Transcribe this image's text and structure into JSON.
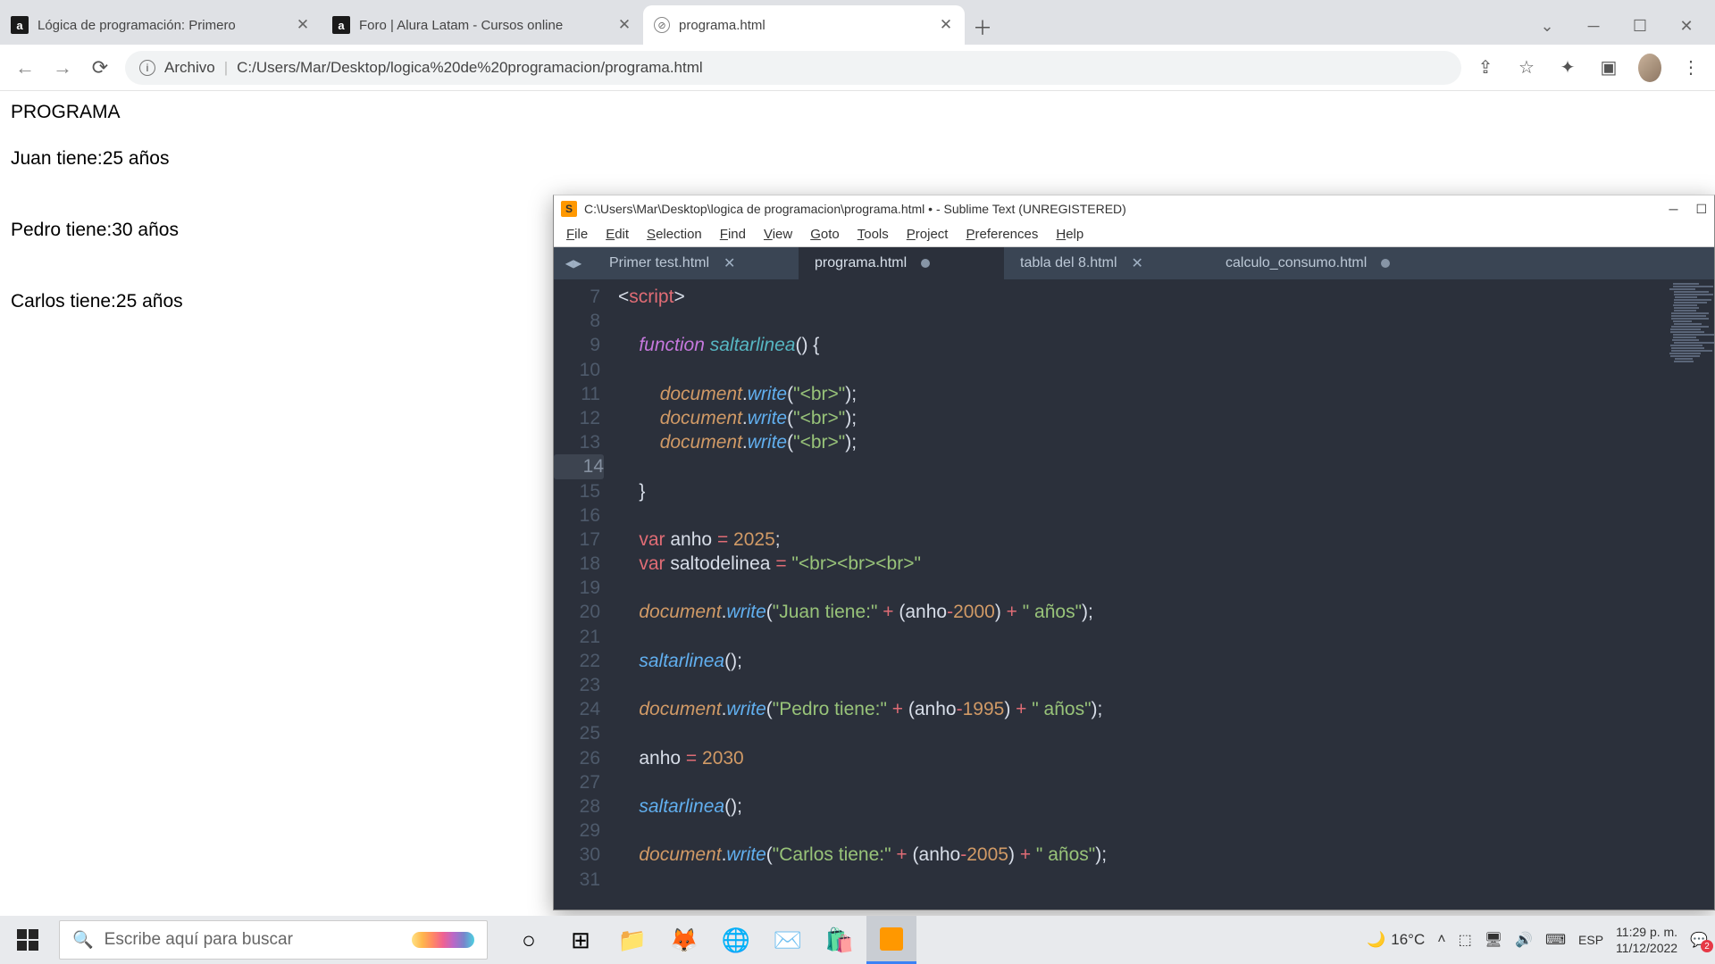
{
  "chrome": {
    "tabs": [
      {
        "title": "Lógica de programación: Primero",
        "favicon": "a"
      },
      {
        "title": "Foro | Alura Latam - Cursos online",
        "favicon": "a"
      },
      {
        "title": "programa.html",
        "favicon": "page",
        "active": true
      }
    ],
    "url_label": "Archivo",
    "url": "C:/Users/Mar/Desktop/logica%20de%20programacion/programa.html"
  },
  "page": {
    "h1": "PROGRAMA",
    "lines": [
      "Juan tiene:25 años",
      "Pedro tiene:30 años",
      "Carlos tiene:25 años"
    ]
  },
  "sublime": {
    "title": "C:\\Users\\Mar\\Desktop\\logica de programacion\\programa.html • - Sublime Text (UNREGISTERED)",
    "menu": [
      "File",
      "Edit",
      "Selection",
      "Find",
      "View",
      "Goto",
      "Tools",
      "Project",
      "Preferences",
      "Help"
    ],
    "tabs": [
      {
        "name": "Primer test.html",
        "state": "close"
      },
      {
        "name": "programa.html",
        "state": "dirty",
        "active": true
      },
      {
        "name": "tabla del 8.html",
        "state": "close"
      },
      {
        "name": "calculo_consumo.html",
        "state": "dirty"
      }
    ],
    "first_line_no": 7,
    "highlighted_line": 14,
    "code": [
      {
        "n": 7,
        "t": "<script>",
        "fmt": "tag"
      },
      {
        "n": 8,
        "t": ""
      },
      {
        "n": 9,
        "t": "    function saltarlinea() {",
        "fmt": "func"
      },
      {
        "n": 10,
        "t": ""
      },
      {
        "n": 11,
        "t": "        document.write(\"<br>\");",
        "fmt": "dw"
      },
      {
        "n": 12,
        "t": "        document.write(\"<br>\");",
        "fmt": "dw"
      },
      {
        "n": 13,
        "t": "        document.write(\"<br>\");",
        "fmt": "dw"
      },
      {
        "n": 14,
        "t": ""
      },
      {
        "n": 15,
        "t": "    }",
        "fmt": "brace"
      },
      {
        "n": 16,
        "t": ""
      },
      {
        "n": 17,
        "t": "    var anho = 2025;",
        "fmt": "var",
        "num": "2025"
      },
      {
        "n": 18,
        "t": "    var saltodelinea = \"<br><br><br>\"",
        "fmt": "var2"
      },
      {
        "n": 19,
        "t": ""
      },
      {
        "n": 20,
        "t": "    document.write(\"Juan tiene:\" + (anho-2000) + \" años\");",
        "fmt": "dw2",
        "s1": "\"Juan tiene:\"",
        "num": "2000"
      },
      {
        "n": 21,
        "t": ""
      },
      {
        "n": 22,
        "t": "    saltarlinea();",
        "fmt": "call"
      },
      {
        "n": 23,
        "t": ""
      },
      {
        "n": 24,
        "t": "    document.write(\"Pedro tiene:\" + (anho-1995) + \" años\");",
        "fmt": "dw2",
        "s1": "\"Pedro tiene:\"",
        "num": "1995"
      },
      {
        "n": 25,
        "t": ""
      },
      {
        "n": 26,
        "t": "    anho = 2030",
        "fmt": "assign",
        "num": "2030"
      },
      {
        "n": 27,
        "t": ""
      },
      {
        "n": 28,
        "t": "    saltarlinea();",
        "fmt": "call"
      },
      {
        "n": 29,
        "t": ""
      },
      {
        "n": 30,
        "t": "    document.write(\"Carlos tiene:\" + (anho-2005) + \" años\");",
        "fmt": "dw2",
        "s1": "\"Carlos tiene:\"",
        "num": "2005"
      },
      {
        "n": 31,
        "t": ""
      }
    ]
  },
  "taskbar": {
    "search_placeholder": "Escribe aquí para buscar",
    "weather_temp": "16°C",
    "lang": "ESP",
    "time": "11:29 p. m.",
    "date": "11/12/2022"
  }
}
